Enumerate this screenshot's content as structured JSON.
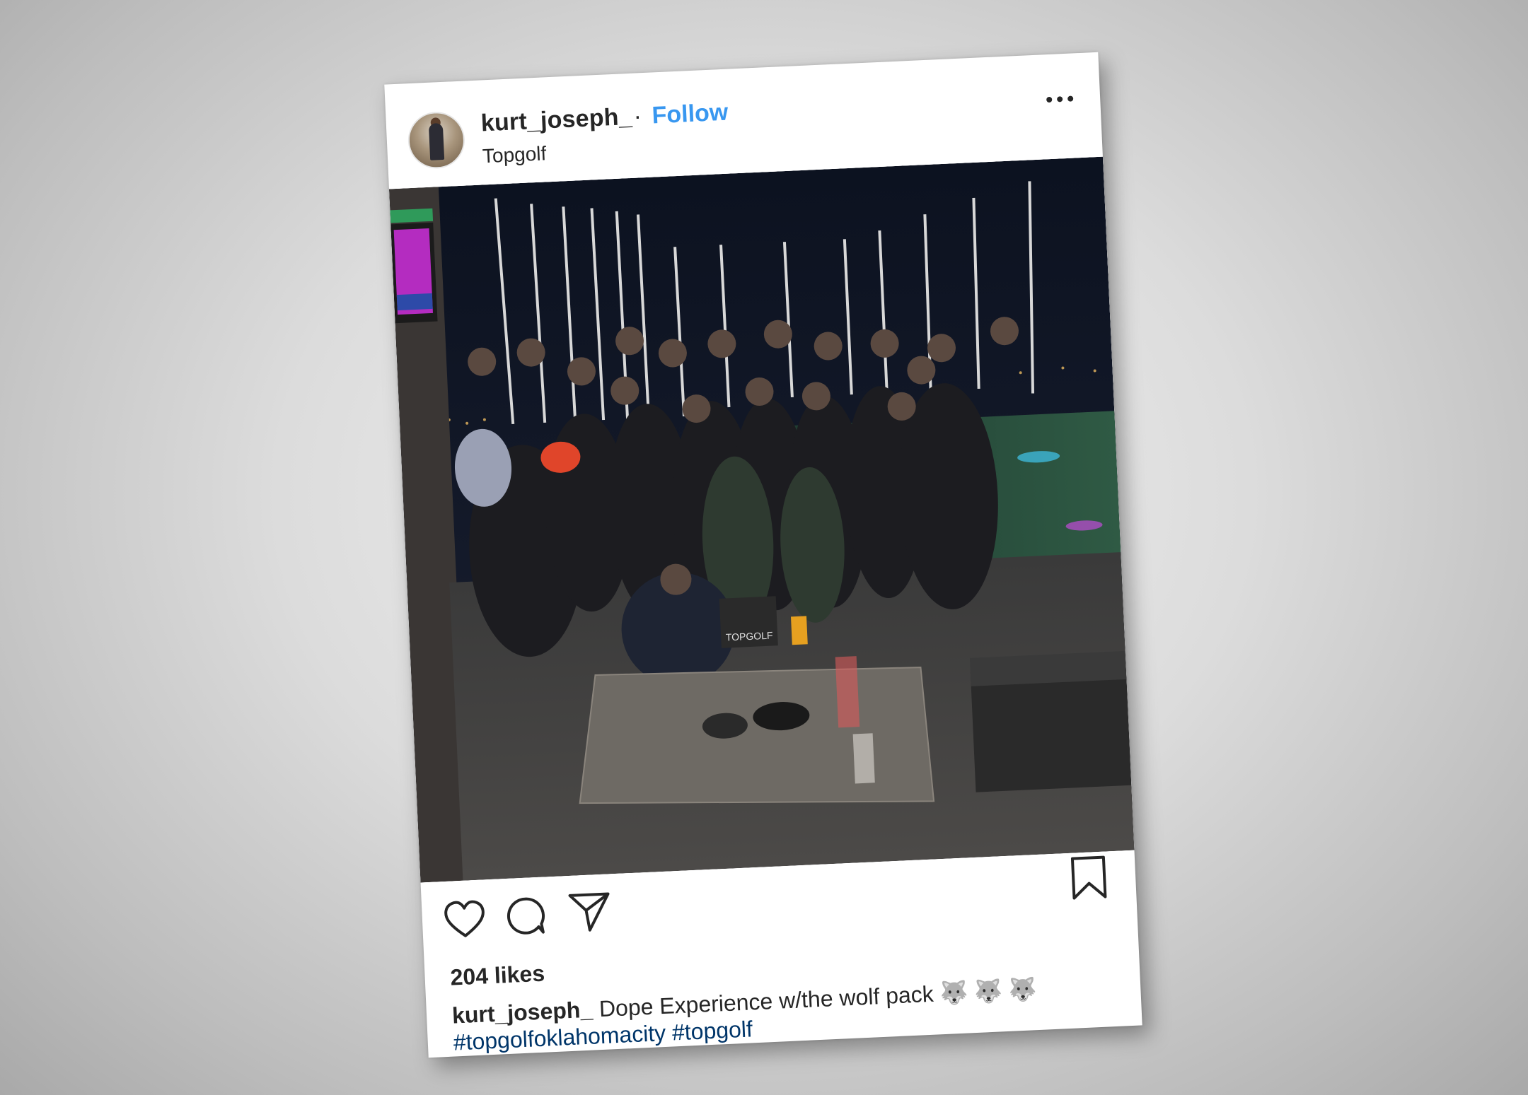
{
  "post": {
    "username": "kurt_joseph_",
    "separator": "·",
    "follow_label": "Follow",
    "location": "Topgolf",
    "more_icon": "more-options-icon",
    "likes": "204 likes",
    "caption": {
      "username": "kurt_joseph_",
      "text": "Dope Experience w/the wolf pack 🐺 🐺 🐺",
      "hashtags": [
        "#topgolfoklahomacity",
        "#topgolf"
      ]
    },
    "photo_signage": {
      "topgolf_sign": "TOPGOLF"
    }
  },
  "actions": {
    "like_icon": "heart-icon",
    "comment_icon": "comment-icon",
    "share_icon": "share-icon",
    "save_icon": "bookmark-icon"
  },
  "colors": {
    "follow": "#3897f0",
    "text": "#262626",
    "hashtag": "#003569"
  }
}
